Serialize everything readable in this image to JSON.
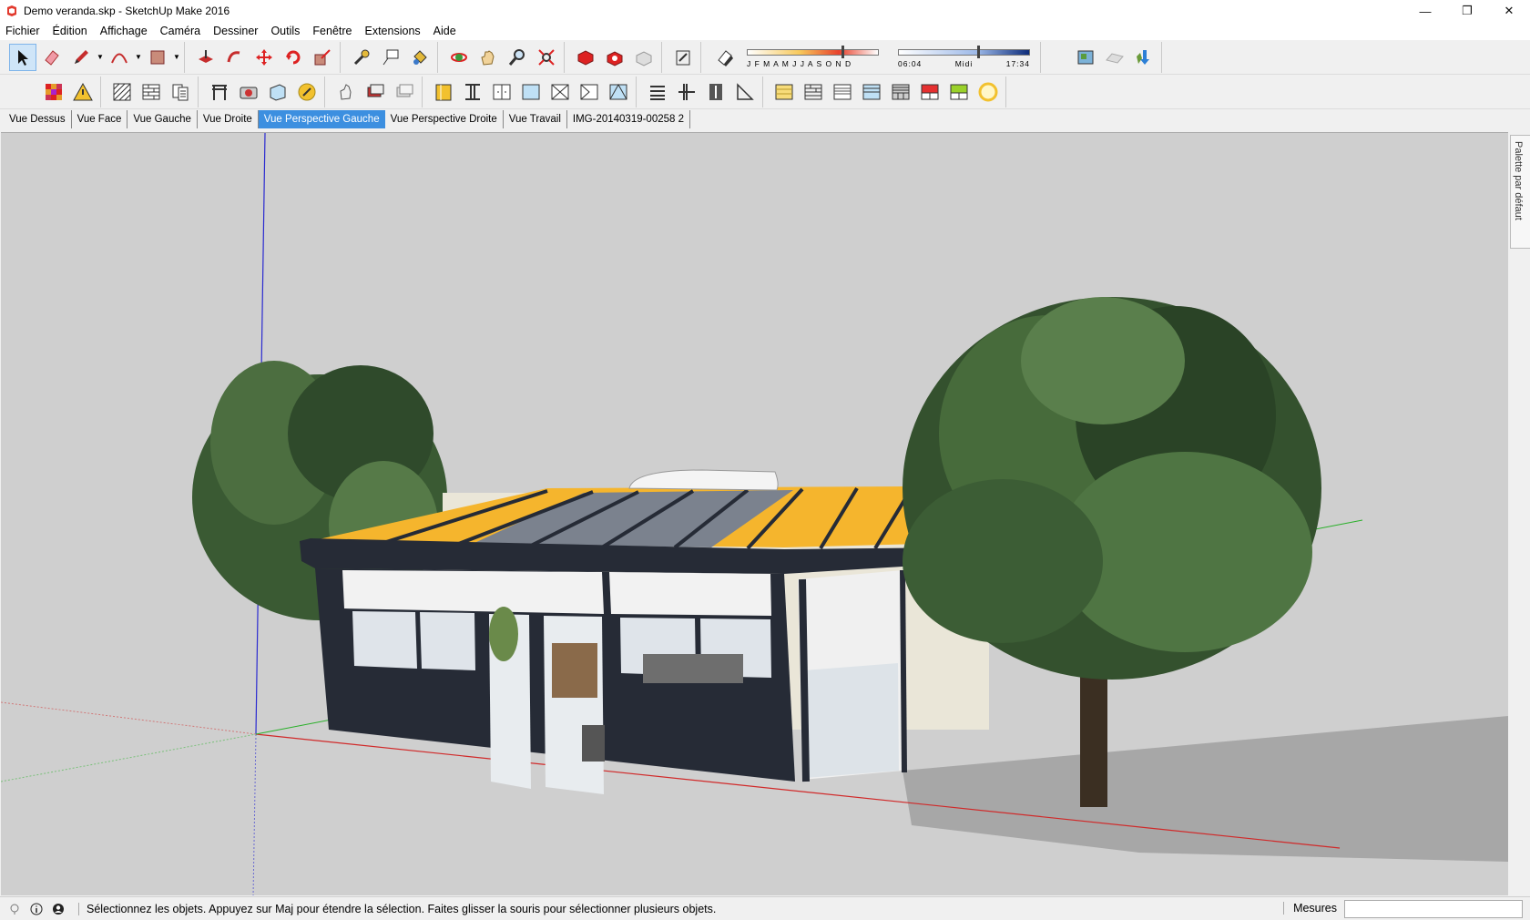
{
  "window": {
    "title": "Demo veranda.skp - SketchUp Make 2016",
    "minimize": "—",
    "maximize": "❐",
    "close": "✕"
  },
  "menu": [
    "Fichier",
    "Édition",
    "Affichage",
    "Caméra",
    "Dessiner",
    "Outils",
    "Fenêtre",
    "Extensions",
    "Aide"
  ],
  "shadows": {
    "months": "J F M A M J J A S O N D",
    "time_start": "06:04",
    "time_mid": "Midi",
    "time_end": "17:34",
    "month_level": 0.72,
    "time_level": 0.6
  },
  "scenes": {
    "tabs": [
      "Vue Dessus",
      "Vue Face",
      "Vue Gauche",
      "Vue Droite",
      "Vue Perspective Gauche",
      "Vue Perspective Droite",
      "Vue Travail",
      "IMG-20140319-00258   2"
    ],
    "active_index": 4
  },
  "tray": {
    "label": "Palette par défaut"
  },
  "status": {
    "message": "Sélectionnez les objets. Appuyez sur Maj pour étendre la sélection. Faites glisser la souris pour sélectionner plusieurs objets.",
    "measures_label": "Mesures",
    "measures_value": ""
  },
  "colors": {
    "accent": "#3c8fe0",
    "roof_yellow": "#f5b52d",
    "frame_dark": "#262b36",
    "sky": "#cfcfcf"
  }
}
